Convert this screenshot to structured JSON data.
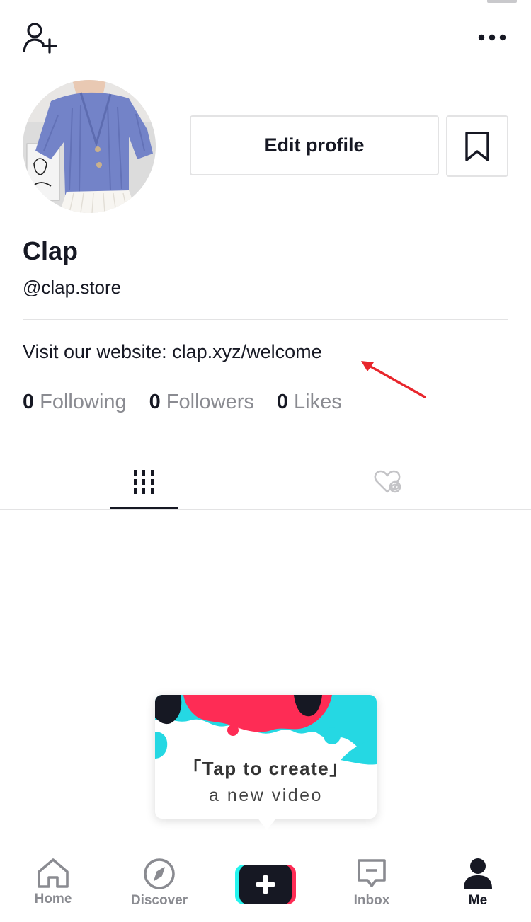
{
  "profile": {
    "display_name": "Clap",
    "handle": "@clap.store",
    "bio": "Visit our website: clap.xyz/welcome",
    "edit_label": "Edit profile"
  },
  "stats": [
    {
      "count": "0",
      "label": "Following"
    },
    {
      "count": "0",
      "label": "Followers"
    },
    {
      "count": "0",
      "label": "Likes"
    }
  ],
  "tabs": [
    {
      "icon": "grid-icon",
      "active": true
    },
    {
      "icon": "liked-hidden-icon",
      "active": false
    }
  ],
  "tooltip": {
    "line1": "「Tap to create」",
    "line2": "a new video"
  },
  "nav": {
    "items": [
      {
        "label": "Home",
        "icon": "home-icon"
      },
      {
        "label": "Discover",
        "icon": "compass-icon"
      },
      {
        "label": "",
        "icon": "plus-icon"
      },
      {
        "label": "Inbox",
        "icon": "inbox-icon"
      },
      {
        "label": "Me",
        "icon": "person-icon",
        "active": true
      }
    ]
  },
  "colors": {
    "text": "#161823",
    "muted": "#8a8b91",
    "border": "#e3e3e4",
    "accent_red": "#fe2c55",
    "accent_cyan": "#25f4ee",
    "annotation_arrow": "#e8262c"
  },
  "icons": {
    "add_friend": "add-friend-icon",
    "more": "more-icon",
    "bookmark": "bookmark-icon",
    "annotation": "red-arrow-annotation"
  }
}
